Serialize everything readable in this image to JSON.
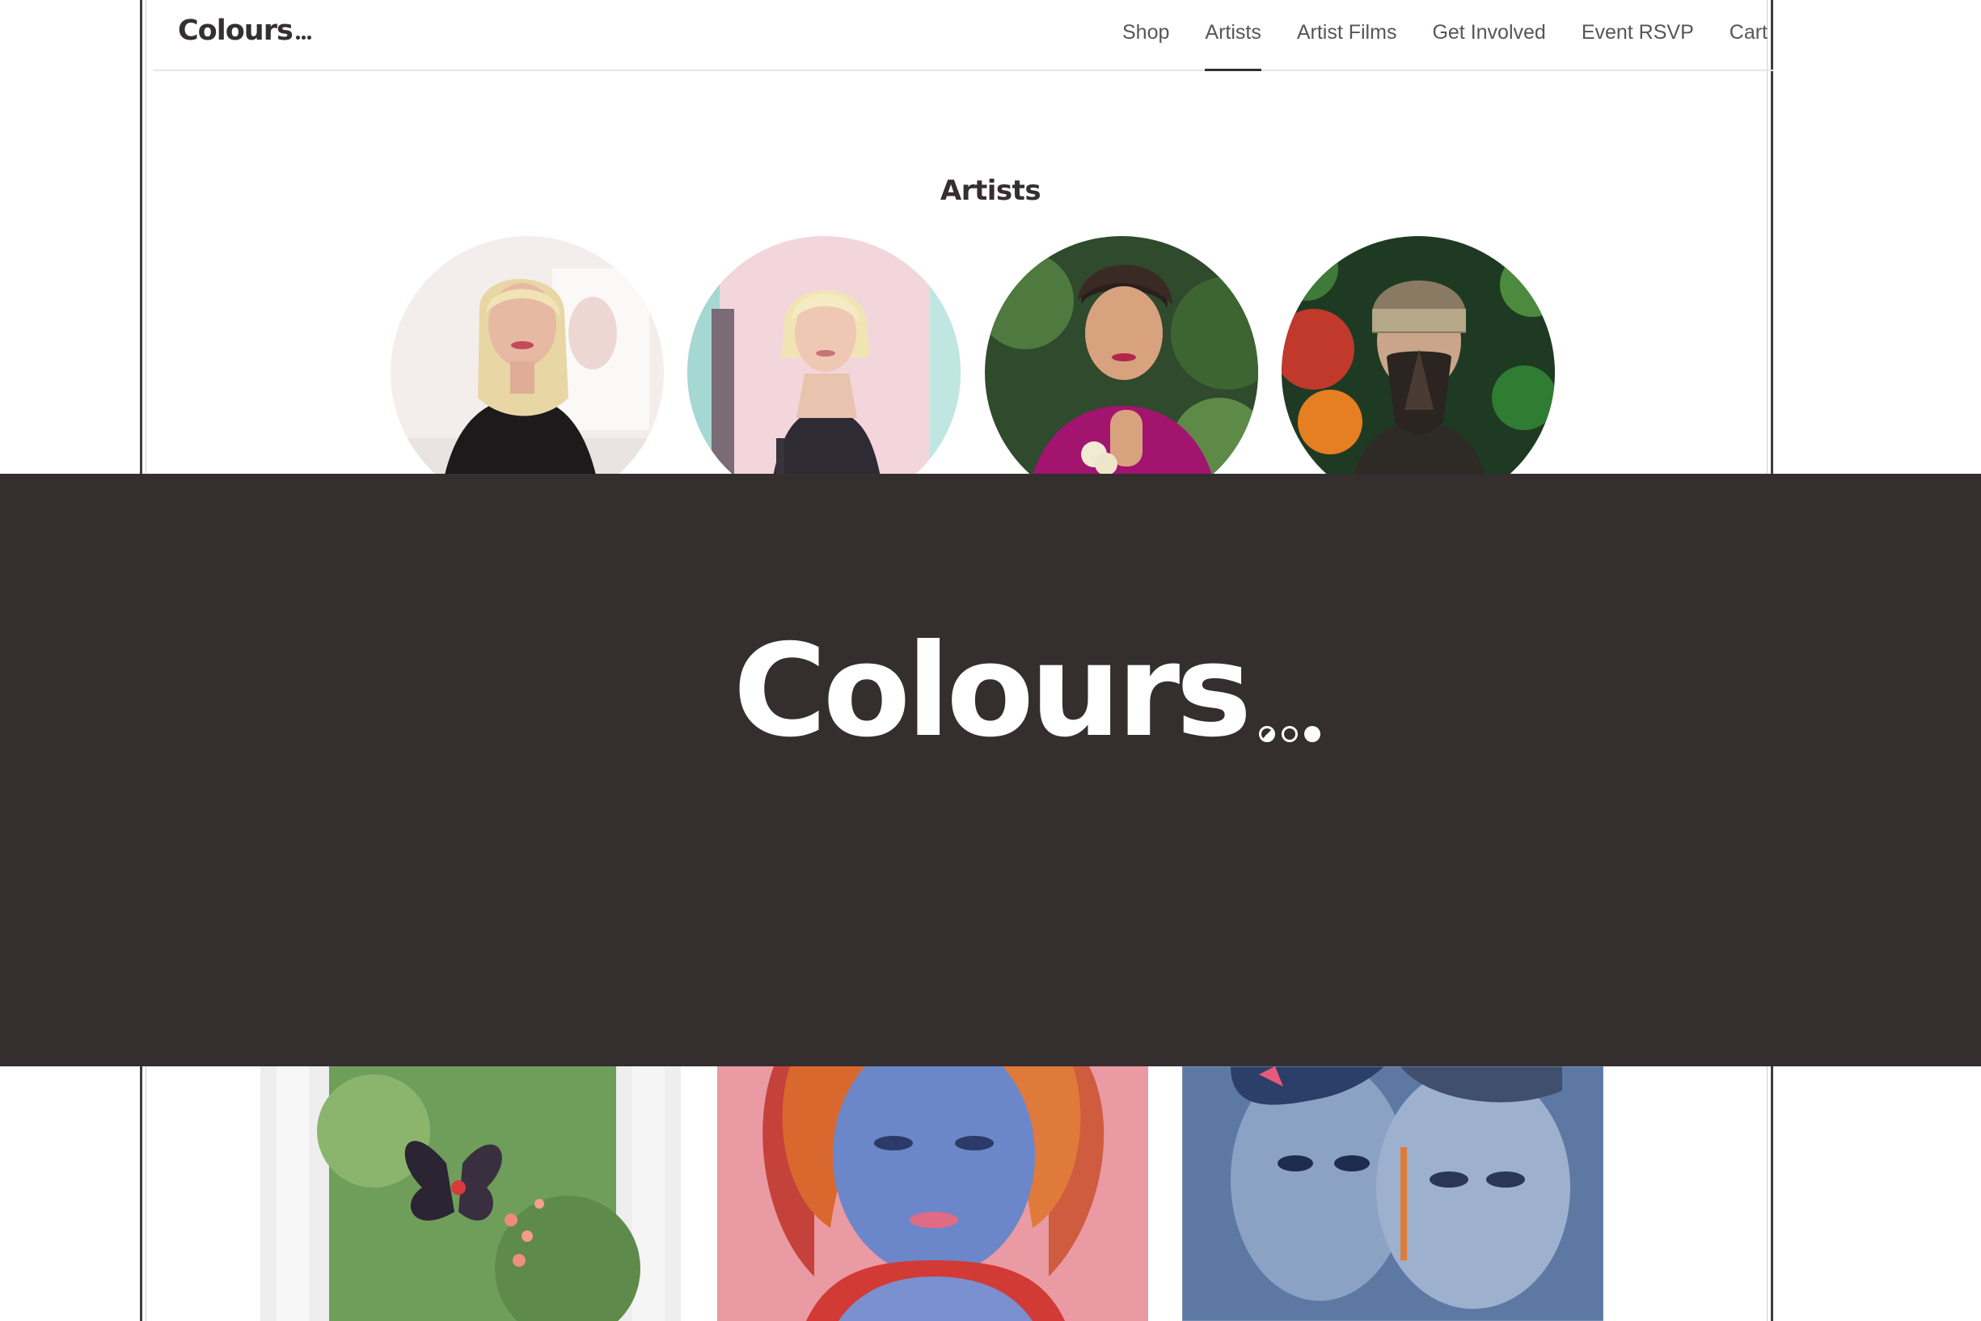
{
  "header": {
    "logo_text": "Colours",
    "nav": [
      {
        "label": "Shop",
        "active": false
      },
      {
        "label": "Artists",
        "active": true
      },
      {
        "label": "Artist Films",
        "active": false
      },
      {
        "label": "Get Involved",
        "active": false
      },
      {
        "label": "Event RSVP",
        "active": false
      },
      {
        "label": "Cart",
        "active": false
      }
    ]
  },
  "main": {
    "section_title": "Artists",
    "artists": [
      {
        "image": "artist-portrait-blonde-black-top"
      },
      {
        "image": "artist-portrait-blonde-lace-bodysuit"
      },
      {
        "image": "artist-portrait-magenta-jacket"
      },
      {
        "image": "artist-portrait-gas-mask-flowers"
      }
    ],
    "artworks": [
      {
        "image": "artwork-butterfly-photo"
      },
      {
        "image": "artwork-blue-woman-portrait"
      },
      {
        "image": "artwork-blue-couple-street-art"
      }
    ]
  },
  "overlay": {
    "logo_text": "Colours",
    "background": "#352e2f"
  },
  "colors": {
    "brand_dark": "#352f30",
    "nav_text": "#5a5455",
    "overlay_bg": "#352e2f"
  }
}
